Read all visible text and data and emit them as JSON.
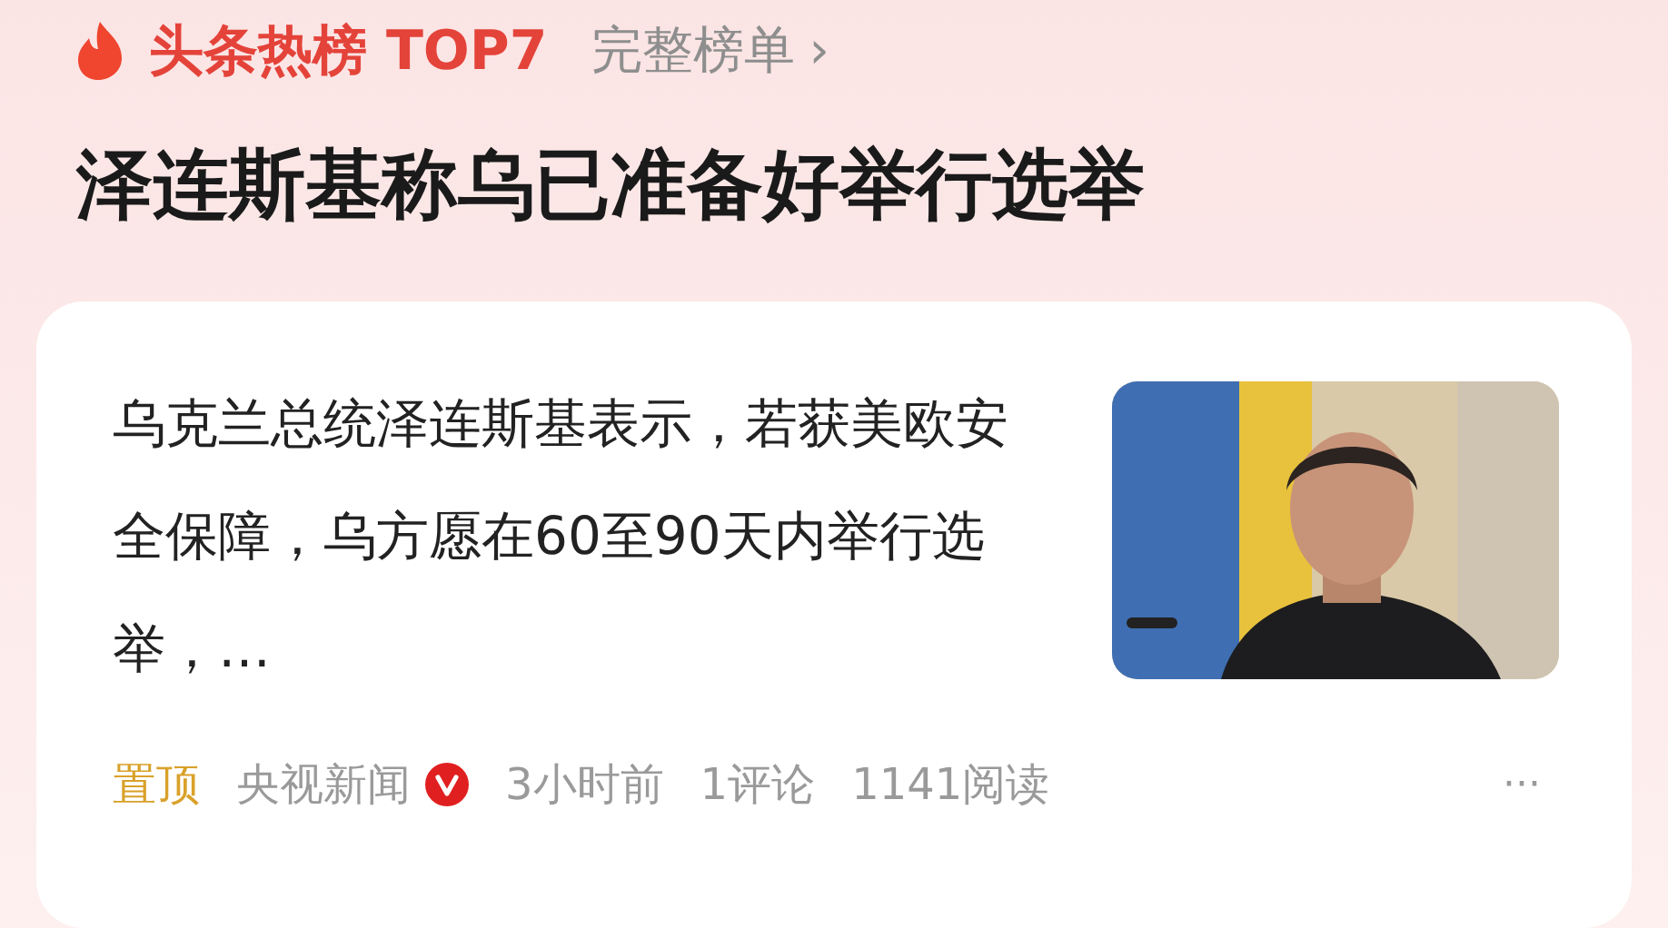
{
  "header": {
    "title": "头条热榜 TOP7",
    "link": "完整榜单",
    "link_arrow": "›"
  },
  "headline": "泽连斯基称乌已准备好举行选举",
  "card": {
    "summary": "乌克兰总统泽连斯基表示，若获美欧安全保障，乌方愿在60至90天内举行选举，…",
    "meta": [
      {
        "kind": "tag",
        "text": "置顶"
      },
      {
        "kind": "source",
        "text": "央视新闻",
        "verified": true
      },
      {
        "kind": "plain",
        "text": "3小时前"
      },
      {
        "kind": "plain",
        "text": "1评论"
      },
      {
        "kind": "plain",
        "text": "1141阅读"
      }
    ],
    "more": "···"
  }
}
